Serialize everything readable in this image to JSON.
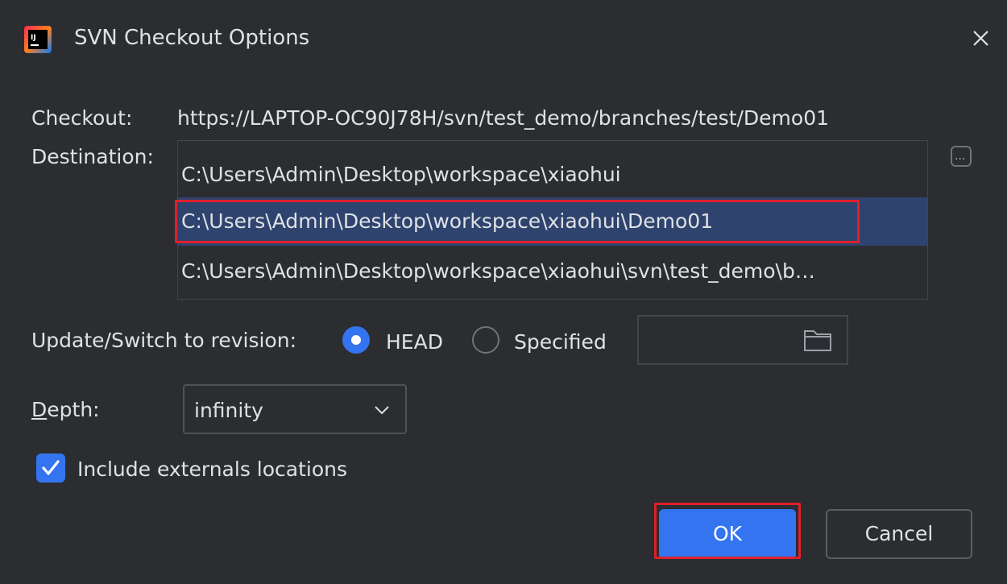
{
  "dialog": {
    "title": "SVN Checkout Options",
    "app_icon": "intellij-idea-icon",
    "close_icon": "close-icon"
  },
  "checkout": {
    "label": "Checkout:",
    "url": "https://LAPTOP-OC90J78H/svn/test_demo/branches/test/Demo01"
  },
  "destination": {
    "label": "Destination:",
    "options": [
      "C:\\Users\\Admin\\Desktop\\workspace\\xiaohui",
      "C:\\Users\\Admin\\Desktop\\workspace\\xiaohui\\Demo01",
      "C:\\Users\\Admin\\Desktop\\workspace\\xiaohui\\svn\\test_demo\\b…"
    ],
    "selected_index": 1,
    "browse_icon": "ellipsis-icon"
  },
  "revision": {
    "label": "Update/Switch to revision:",
    "head_label": "HEAD",
    "specified_label": "Specified",
    "selected": "HEAD",
    "browse_icon": "folder-icon"
  },
  "depth": {
    "label_first": "D",
    "label_rest": "epth:",
    "value": "infinity",
    "dropdown_icon": "chevron-down-icon"
  },
  "externals": {
    "label": "Include externals locations",
    "checked": true
  },
  "buttons": {
    "ok": "OK",
    "cancel": "Cancel"
  },
  "colors": {
    "background": "#2b2d30",
    "accent": "#3574f0",
    "selection": "#2e436e",
    "highlight": "#e0202a"
  }
}
